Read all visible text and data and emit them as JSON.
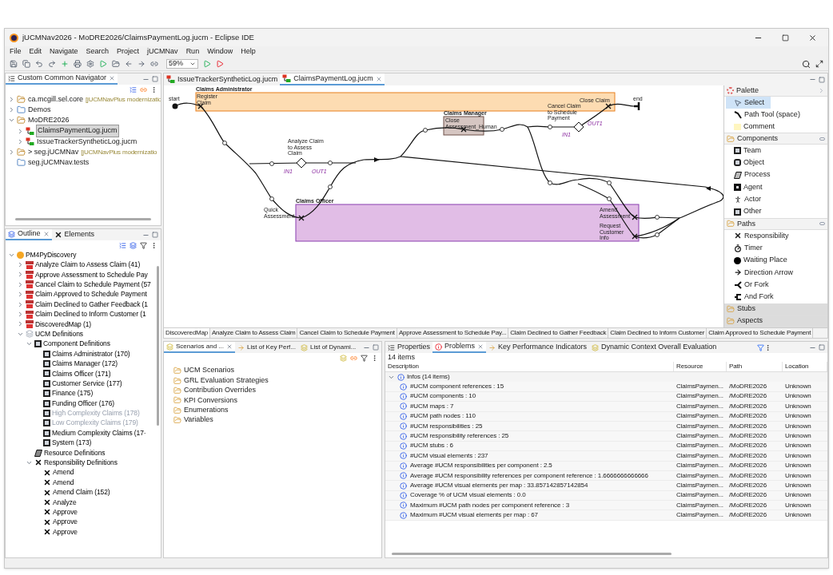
{
  "window": {
    "title": "jUCMNav2026 - MoDRE2026/ClaimsPaymentLog.jucm - Eclipse IDE"
  },
  "menu": [
    "File",
    "Edit",
    "Navigate",
    "Search",
    "Project",
    "jUCMNav",
    "Run",
    "Window",
    "Help"
  ],
  "toolbar": {
    "zoom": "59%"
  },
  "navigator": {
    "title": "Custom Common Navigator",
    "items": [
      {
        "label": "ca.mcgill.sel.core",
        "decoration": "[jUCMNavPlus modernizatio",
        "kind": "project",
        "expanded": false,
        "selected": false
      },
      {
        "label": "Demos",
        "kind": "folder",
        "expanded": false,
        "selected": false
      },
      {
        "label": "MoDRE2026",
        "kind": "project",
        "expanded": true,
        "selected": false,
        "children": [
          {
            "label": "ClaimsPaymentLog.jucm",
            "kind": "map",
            "expanded": false,
            "selected": true
          },
          {
            "label": "IssueTrackerSyntheticLog.jucm",
            "kind": "map",
            "expanded": false,
            "selected": false
          }
        ]
      },
      {
        "label": "> seg.jUCMNav",
        "decoration": "[jUCMNavPlus modernizatio",
        "kind": "project",
        "expanded": false,
        "selected": false
      },
      {
        "label": "seg.jUCMNav.tests",
        "kind": "folder",
        "selected": false
      }
    ]
  },
  "outline": {
    "tabs": [
      {
        "label": "Outline",
        "selected": true
      },
      {
        "label": "Elements",
        "selected": false
      }
    ],
    "tree": [
      {
        "label": "PM4PyDiscovery",
        "kind": "root",
        "expanded": true,
        "children": [
          {
            "label": "Analyze Claim to Assess Claim (41)",
            "kind": "map",
            "expanded": false
          },
          {
            "label": "Approve Assessment to Schedule Pay",
            "kind": "map",
            "expanded": false
          },
          {
            "label": "Cancel Claim to Schedule Payment (57",
            "kind": "map",
            "expanded": false
          },
          {
            "label": "Claim Approved to Schedule Payment",
            "kind": "map",
            "expanded": false
          },
          {
            "label": "Claim Declined to Gather Feedback (1",
            "kind": "map",
            "expanded": false
          },
          {
            "label": "Claim Declined to Inform Customer (1",
            "kind": "map",
            "expanded": false
          },
          {
            "label": "DiscoveredMap (1)",
            "kind": "map",
            "expanded": false
          },
          {
            "label": "UCM Definitions",
            "kind": "definitions",
            "expanded": true,
            "children": [
              {
                "label": "Component Definitions",
                "kind": "component-group",
                "expanded": true,
                "children": [
                  {
                    "label": "Claims Administrator (170)",
                    "kind": "component",
                    "disabled": false
                  },
                  {
                    "label": "Claims Manager (172)",
                    "kind": "component",
                    "disabled": false
                  },
                  {
                    "label": "Claims Officer (171)",
                    "kind": "component",
                    "disabled": false
                  },
                  {
                    "label": "Customer Service (177)",
                    "kind": "component",
                    "disabled": false
                  },
                  {
                    "label": "Finance (175)",
                    "kind": "component",
                    "disabled": false
                  },
                  {
                    "label": "Funding Officer (176)",
                    "kind": "component",
                    "disabled": false
                  },
                  {
                    "label": "High Complexity Claims (178)",
                    "kind": "component",
                    "disabled": true
                  },
                  {
                    "label": "Low Complexity Claims (179)",
                    "kind": "component",
                    "disabled": true
                  },
                  {
                    "label": "Medium Complexity Claims (17·",
                    "kind": "component",
                    "disabled": false
                  },
                  {
                    "label": "System (173)",
                    "kind": "component",
                    "disabled": false
                  }
                ]
              },
              {
                "label": "Resource Definitions",
                "kind": "resource-group"
              },
              {
                "label": "Responsibility Definitions",
                "kind": "responsibility-group",
                "expanded": true,
                "children": [
                  {
                    "label": "Amend",
                    "kind": "responsibility"
                  },
                  {
                    "label": "Amend",
                    "kind": "responsibility"
                  },
                  {
                    "label": "Amend Claim (152)",
                    "kind": "responsibility"
                  },
                  {
                    "label": "Analyze",
                    "kind": "responsibility"
                  },
                  {
                    "label": "Approve",
                    "kind": "responsibility"
                  },
                  {
                    "label": "Approve",
                    "kind": "responsibility"
                  },
                  {
                    "label": "Approve",
                    "kind": "responsibility"
                  }
                ]
              }
            ]
          }
        ]
      }
    ]
  },
  "editor_tabs": [
    {
      "label": "IssueTrackerSyntheticLog.jucm",
      "selected": false
    },
    {
      "label": "ClaimsPaymentLog.jucm",
      "selected": true
    }
  ],
  "diagram": {
    "start": "start",
    "end": "end",
    "components": [
      {
        "name": "Claims Administrator",
        "color": "#fddcb2"
      },
      {
        "name": "Claims Manager",
        "color": "#d6c6c2"
      },
      {
        "name": "Claims Officer",
        "color": "#e1bde6"
      }
    ],
    "responsibilities": [
      "Register Claim",
      "Close Claim",
      "Close Assessment_Human",
      "Quick Assessment",
      "Amend Assessment",
      "Request Customer Info"
    ],
    "stubs": [
      {
        "label": "Analyze Claim to Assess Claim",
        "in": "IN1",
        "out": "OUT1"
      },
      {
        "label": "Cancel Claim to Schedule Payment",
        "in": "IN1",
        "out": "OUT1"
      }
    ]
  },
  "palette": {
    "title": "Palette",
    "tools": [
      {
        "label": "Select",
        "kind": "select",
        "selected": true
      },
      {
        "label": "Path Tool (space)",
        "kind": "path",
        "selected": false
      },
      {
        "label": "Comment",
        "kind": "comment",
        "selected": false
      }
    ],
    "drawers": [
      {
        "label": "Components",
        "expanded": true,
        "items": [
          {
            "label": "Team",
            "kind": "team"
          },
          {
            "label": "Object",
            "kind": "object"
          },
          {
            "label": "Process",
            "kind": "process"
          },
          {
            "label": "Agent",
            "kind": "agent"
          },
          {
            "label": "Actor",
            "kind": "actor"
          },
          {
            "label": "Other",
            "kind": "other"
          }
        ]
      },
      {
        "label": "Paths",
        "expanded": true,
        "items": [
          {
            "label": "Responsibility",
            "kind": "responsibility"
          },
          {
            "label": "Timer",
            "kind": "timer"
          },
          {
            "label": "Waiting Place",
            "kind": "waiting"
          },
          {
            "label": "Direction Arrow",
            "kind": "arrow"
          },
          {
            "label": "Or Fork",
            "kind": "orfork"
          },
          {
            "label": "And Fork",
            "kind": "andfork"
          }
        ]
      },
      {
        "label": "Stubs",
        "expanded": false
      },
      {
        "label": "Aspects",
        "expanded": false
      }
    ]
  },
  "map_tabs": [
    {
      "label": "DiscoveredMap",
      "selected": true
    },
    {
      "label": "Analyze Claim to Assess Claim",
      "selected": false
    },
    {
      "label": "Cancel Claim to Schedule Payment",
      "selected": false
    },
    {
      "label": "Approve Assessment to Schedule Pay...",
      "selected": false
    },
    {
      "label": "Claim Declined to Gather Feedback",
      "selected": false
    },
    {
      "label": "Claim Declined to Inform Customer",
      "selected": false
    },
    {
      "label": "Claim Approved to Schedule Payment",
      "selected": false
    }
  ],
  "scenarios": {
    "tabs": [
      {
        "label": "Scenarios and ...",
        "selected": true
      },
      {
        "label": "List of Key Perf...",
        "selected": false
      },
      {
        "label": "List of Dynami...",
        "selected": false
      }
    ],
    "items": [
      "UCM Scenarios",
      "GRL Evaluation Strategies",
      "Contribution Overrides",
      "KPI Conversions",
      "Enumerations",
      "Variables"
    ]
  },
  "problems": {
    "tabs": [
      {
        "label": "Properties",
        "selected": false
      },
      {
        "label": "Problems",
        "selected": true
      },
      {
        "label": "Key Performance Indicators",
        "selected": false
      },
      {
        "label": "Dynamic Context Overall Evaluation",
        "selected": false
      }
    ],
    "count": "14 items",
    "columns": [
      "Description",
      "Resource",
      "Path",
      "Location"
    ],
    "group": {
      "label": "Infos (14 items)",
      "expanded": true
    },
    "rows": [
      {
        "description": "#UCM component references : 15",
        "resource": "ClaimsPaymen...",
        "path": "/MoDRE2026",
        "location": "Unknown"
      },
      {
        "description": "#UCM components : 10",
        "resource": "ClaimsPaymen...",
        "path": "/MoDRE2026",
        "location": "Unknown"
      },
      {
        "description": "#UCM maps : 7",
        "resource": "ClaimsPaymen...",
        "path": "/MoDRE2026",
        "location": "Unknown"
      },
      {
        "description": "#UCM path nodes : 110",
        "resource": "ClaimsPaymen...",
        "path": "/MoDRE2026",
        "location": "Unknown"
      },
      {
        "description": "#UCM responsibilities : 25",
        "resource": "ClaimsPaymen...",
        "path": "/MoDRE2026",
        "location": "Unknown"
      },
      {
        "description": "#UCM responsibility references : 25",
        "resource": "ClaimsPaymen...",
        "path": "/MoDRE2026",
        "location": "Unknown"
      },
      {
        "description": "#UCM stubs : 6",
        "resource": "ClaimsPaymen...",
        "path": "/MoDRE2026",
        "location": "Unknown"
      },
      {
        "description": "#UCM visual elements : 237",
        "resource": "ClaimsPaymen...",
        "path": "/MoDRE2026",
        "location": "Unknown"
      },
      {
        "description": "Average #UCM responsibilities per component : 2.5",
        "resource": "ClaimsPaymen...",
        "path": "/MoDRE2026",
        "location": "Unknown"
      },
      {
        "description": "Average #UCM responsibility references per component reference : 1.6666666666666",
        "resource": "ClaimsPaymen...",
        "path": "/MoDRE2026",
        "location": "Unknown"
      },
      {
        "description": "Average #UCM visual elements per map : 33.857142857142854",
        "resource": "ClaimsPaymen...",
        "path": "/MoDRE2026",
        "location": "Unknown"
      },
      {
        "description": "Coverage % of UCM visual elements : 0.0",
        "resource": "ClaimsPaymen...",
        "path": "/MoDRE2026",
        "location": "Unknown"
      },
      {
        "description": "Maximum #UCM path nodes per component reference : 3",
        "resource": "ClaimsPaymen...",
        "path": "/MoDRE2026",
        "location": "Unknown"
      },
      {
        "description": "Maximum #UCM visual elements per map : 67",
        "resource": "ClaimsPaymen...",
        "path": "/MoDRE2026",
        "location": "Unknown"
      }
    ]
  }
}
